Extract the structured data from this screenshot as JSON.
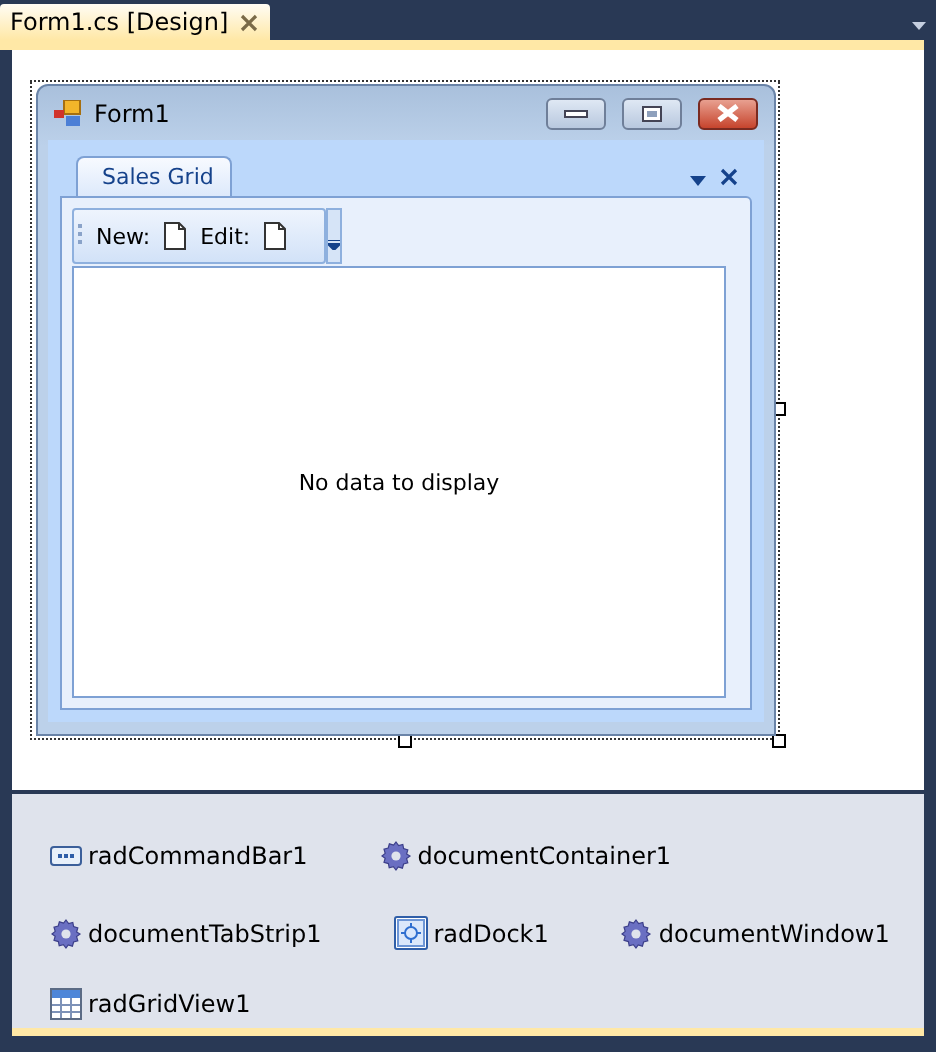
{
  "document_tab": {
    "title": "Form1.cs [Design]",
    "selected": true
  },
  "form": {
    "title": "Form1",
    "dock_tabs": [
      {
        "label": "Sales Grid",
        "selected": true
      }
    ],
    "command_bar": {
      "items": [
        {
          "kind": "label",
          "text": "New:"
        },
        {
          "kind": "button"
        },
        {
          "kind": "label",
          "text": "Edit:"
        },
        {
          "kind": "button"
        }
      ]
    },
    "grid": {
      "empty_text": "No data to display"
    }
  },
  "tray": {
    "rows": [
      [
        {
          "kind": "commandbar",
          "name": "radCommandBar1"
        },
        {
          "kind": "gear",
          "name": "documentContainer1"
        }
      ],
      [
        {
          "kind": "gear",
          "name": "documentTabStrip1"
        },
        {
          "kind": "dock",
          "name": "radDock1"
        },
        {
          "kind": "gear",
          "name": "documentWindow1"
        }
      ],
      [
        {
          "kind": "grid",
          "name": "radGridView1"
        }
      ]
    ]
  }
}
